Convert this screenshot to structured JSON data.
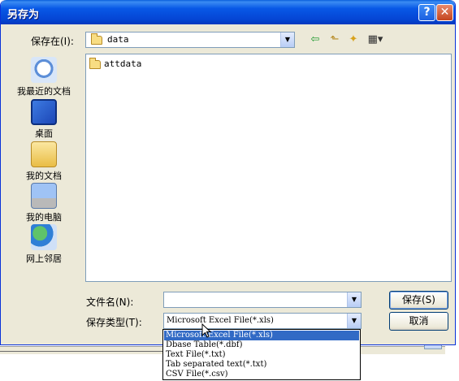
{
  "window": {
    "title": "另存为",
    "help_glyph": "?",
    "close_glyph": "✕"
  },
  "save_in": {
    "label": "保存在(I):",
    "value": "data"
  },
  "toolbar": {
    "back_glyph": "⇦",
    "up_glyph": "⬑",
    "newfolder_glyph": "✦",
    "views_glyph": "▦▾"
  },
  "places": [
    {
      "label": "我最近的文档",
      "icon": "recent-documents-icon"
    },
    {
      "label": "桌面",
      "icon": "desktop-icon"
    },
    {
      "label": "我的文档",
      "icon": "my-documents-icon"
    },
    {
      "label": "我的电脑",
      "icon": "my-computer-icon"
    },
    {
      "label": "网上邻居",
      "icon": "network-places-icon"
    }
  ],
  "files": [
    {
      "name": "attdata",
      "type": "folder"
    }
  ],
  "filename": {
    "label": "文件名(N):",
    "value": ""
  },
  "filetype": {
    "label": "保存类型(T):",
    "value": "Microsoft Excel File(*.xls)",
    "options": [
      "Microsoft Excel File(*.xls)",
      "Dbase Table(*.dbf)",
      "Text File(*.txt)",
      "Tab separated text(*.txt)",
      "CSV File(*.csv)"
    ]
  },
  "buttons": {
    "save": "保存(S)",
    "cancel": "取消"
  },
  "colors": {
    "titlebar": "#0545d4",
    "dialog_bg": "#ece9d8",
    "selection": "#316ac5",
    "border": "#7f9db9"
  }
}
